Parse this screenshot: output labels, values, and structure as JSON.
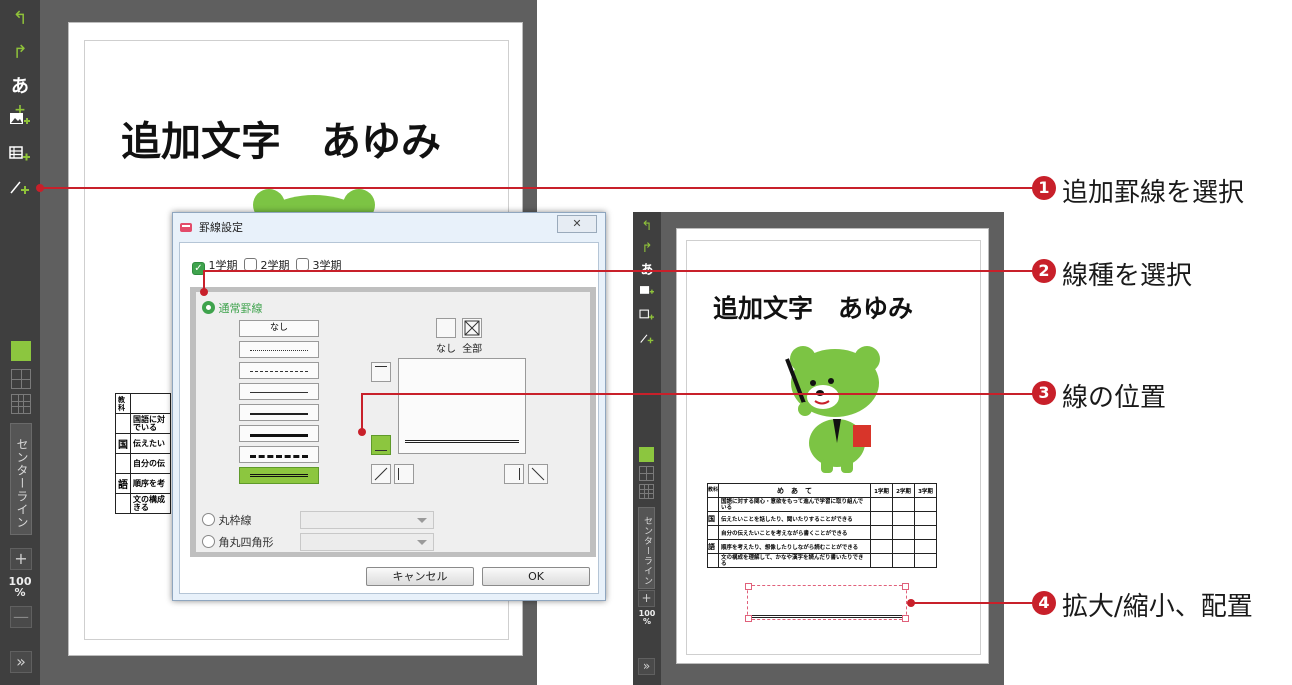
{
  "left_editor": {
    "toolbar": {
      "undo_icon": "undo-icon",
      "redo_icon": "redo-icon",
      "add_text_glyph": "あ",
      "add_image_icon": "add-image-icon",
      "add_table_icon": "add-table-icon",
      "add_line_icon": "add-line-icon",
      "center_line_label": "センターライン",
      "zoom_in": "+",
      "zoom_value": "100",
      "zoom_unit": "%",
      "zoom_out": "—",
      "expand": "»"
    },
    "document": {
      "title": "追加文字　あゆみ",
      "table": {
        "corner_label": "教科",
        "subject_chars": [
          "国",
          "語"
        ],
        "rows": [
          "国語に対\nでいる",
          "伝えたい",
          "自分の伝",
          "順序を考",
          "文の構成\nきる"
        ]
      }
    }
  },
  "dialog": {
    "title": "罫線設定",
    "close": "✕",
    "terms": [
      {
        "label": "1学期",
        "checked": true
      },
      {
        "label": "2学期",
        "checked": false
      },
      {
        "label": "3学期",
        "checked": false
      }
    ],
    "normal_line_label": "通常罫線",
    "line_type_none": "なし",
    "line_types": [
      "dotted-fine",
      "dashed",
      "thin",
      "medium",
      "thick",
      "dashed-thick",
      "double-selected"
    ],
    "none_label": "なし",
    "all_label": "全部",
    "round_frame_label": "丸枠線",
    "rounded_rect_label": "角丸四角形",
    "cancel_label": "キャンセル",
    "ok_label": "OK"
  },
  "right_editor": {
    "document": {
      "title": "追加文字　あゆみ",
      "table": {
        "corner_label": "教科",
        "header": "め　あ　て",
        "term_headers": [
          "1学期",
          "2学期",
          "3学期"
        ],
        "subject_chars": [
          "国",
          "語"
        ],
        "rows": [
          "国語に対する関心・意欲をもって進んで学習に取り組んでいる",
          "伝えたいことを話したり、聞いたりすることができる",
          "自分の伝えたいことを考えながら書くことができる",
          "順序を考えたり、想像したりしながら読むことができる",
          "文の構成を理解して、かなや漢字を読んだり書いたりできる"
        ]
      }
    },
    "zoom_value": "100",
    "zoom_unit": "%"
  },
  "callouts": [
    {
      "number": "1",
      "label": "追加罫線を選択"
    },
    {
      "number": "2",
      "label": "線種を選択"
    },
    {
      "number": "3",
      "label": "線の位置"
    },
    {
      "number": "4",
      "label": "拡大/縮小、配置"
    }
  ],
  "colors": {
    "accent_green": "#8cc63f",
    "callout_red": "#c8202a",
    "toolbar_dark": "#3f3f3f",
    "canvas_gray": "#5f5f5f"
  }
}
